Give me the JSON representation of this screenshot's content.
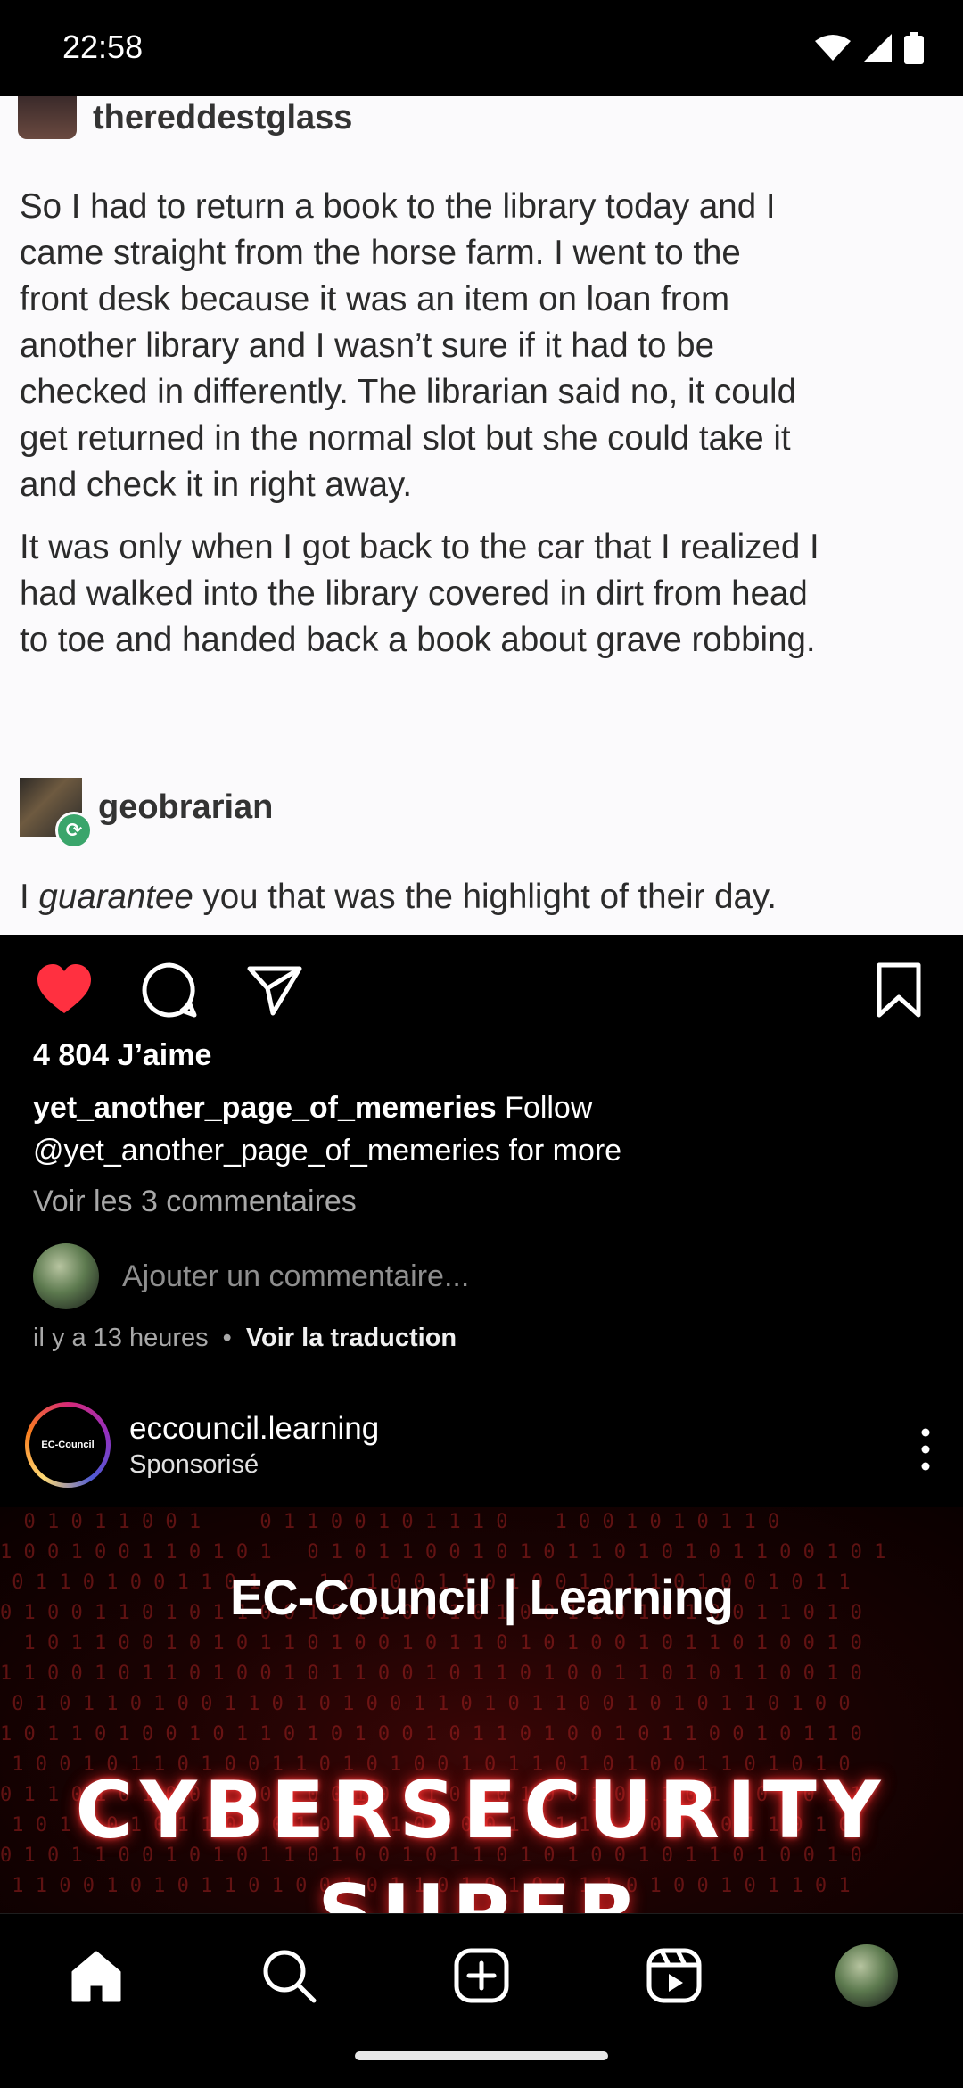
{
  "status_bar": {
    "time": "22:58"
  },
  "post": {
    "image": {
      "op_username": "thereddestglass",
      "op_paragraph_1_lines": [
        "So I had to return a book to the library today and I",
        "came straight from the horse farm. I went to the",
        "front desk because it was an item on loan from",
        "another library and I wasn’t sure if it had to be",
        "checked in differently. The librarian said no, it could",
        "get returned in the normal slot but she could take it",
        "and check it in right away."
      ],
      "op_paragraph_2_lines": [
        "It was only when I got back to the car that I realized I",
        "had walked into the library covered in dirt from head",
        "to toe and handed back a book about grave robbing."
      ],
      "reblog_username": "geobrarian",
      "reblog_text_prefix": "I ",
      "reblog_text_emphasis": "guarantee",
      "reblog_text_suffix": " you that was the highlight of their day."
    },
    "likes": "4 804 J’aime",
    "caption_user": "yet_another_page_of_memeries",
    "caption_text": "Follow @yet_another_page_of_memeries for more",
    "view_comments": "Voir les 3 commentaires",
    "comment_placeholder": "Ajouter un commentaire...",
    "time_ago": "il y a 13 heures",
    "meta_separator": "•",
    "translate": "Voir la traduction",
    "like_color": "#ff3040"
  },
  "sponsored": {
    "username": "eccouncil.learning",
    "label": "Sponsorisé",
    "avatar_text": "EC-Council",
    "ad_brand": "EC-Council | Learning",
    "ad_headline": "CYBERSECURITY",
    "ad_headline2": "SUPER"
  },
  "icons": {
    "like": "heart-icon",
    "comment": "comment-icon",
    "share": "send-icon",
    "save": "bookmark-icon",
    "more": "more-vertical-icon",
    "nav": [
      "home-icon",
      "search-icon",
      "create-icon",
      "reels-icon",
      "profile-avatar"
    ]
  }
}
